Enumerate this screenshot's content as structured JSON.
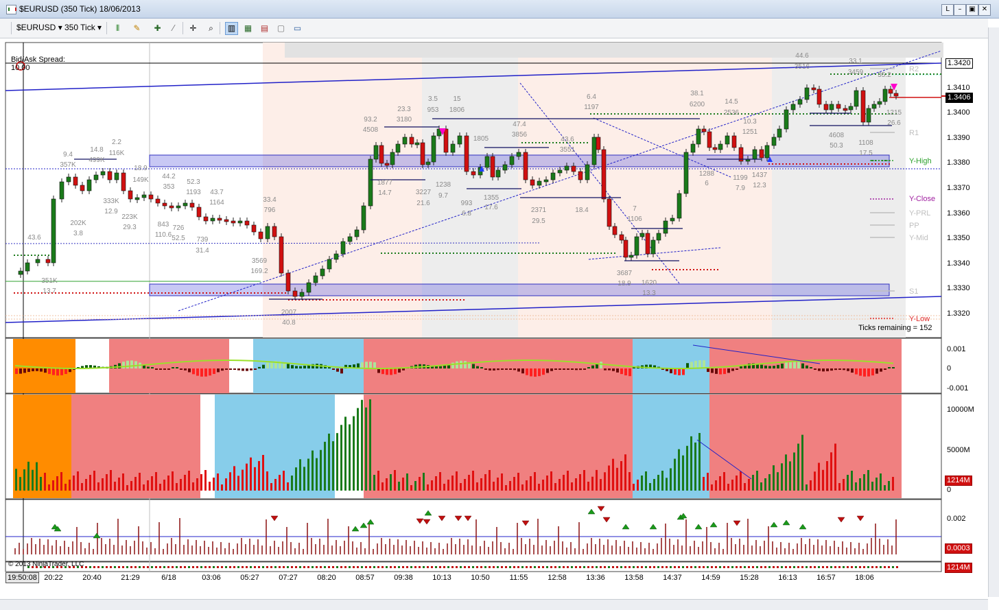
{
  "window": {
    "title": "$EURUSD (350 Tick)  18/06/2013",
    "controls": [
      "L",
      "–",
      "▣",
      "✕"
    ]
  },
  "toolbar": {
    "instrument": "$EURUSD",
    "interval": "350 Tick"
  },
  "overlay": {
    "spread_label": "Bid/Ask Spread:",
    "spread_value": "10.00",
    "ticks_remaining": "Ticks remaining = 152",
    "copyright": "© 2013 NinjaTrader, LLC",
    "clock": "19:50:08"
  },
  "price_axis": {
    "ticks": [
      "1.3410",
      "1.3400",
      "1.3390",
      "1.3380",
      "1.3370",
      "1.3360",
      "1.3350",
      "1.3340",
      "1.3330",
      "1.3320"
    ],
    "top_box": "1.3420",
    "last_price_box": "1.3406"
  },
  "levels_legend": [
    {
      "label": "R2",
      "color": "#bfbfbf"
    },
    {
      "label": "R1",
      "color": "#bfbfbf"
    },
    {
      "label": "Y-High",
      "color": "#2ca02c"
    },
    {
      "label": "Y-Close",
      "color": "#a020a0"
    },
    {
      "label": "Y-PRL",
      "color": "#bfbfbf"
    },
    {
      "label": "PP",
      "color": "#bfbfbf"
    },
    {
      "label": "Y-Mid",
      "color": "#bfbfbf"
    },
    {
      "label": "S1",
      "color": "#bfbfbf"
    },
    {
      "label": "Y-Low",
      "color": "#e03030"
    }
  ],
  "indicator1_axis": {
    "ticks": [
      "0.001",
      "0",
      "-0.001"
    ]
  },
  "indicator2_axis": {
    "ticks": [
      "10000M",
      "5000M",
      "0"
    ],
    "box": "1214M"
  },
  "indicator3_axis": {
    "ticks": [
      "0.002"
    ],
    "box": "0.0003"
  },
  "indicator4_axis": {
    "box": "1214M"
  },
  "time_axis": [
    "20:22",
    "20:40",
    "21:29",
    "6/18",
    "03:06",
    "05:27",
    "07:27",
    "08:20",
    "08:57",
    "09:38",
    "10:13",
    "10:50",
    "11:55",
    "12:58",
    "13:36",
    "13:58",
    "14:37",
    "14:59",
    "15:28",
    "16:13",
    "16:57",
    "18:06"
  ],
  "swing_labels": [
    "43.6",
    "9.4",
    "357K",
    "14.8",
    "499K",
    "2.2",
    "116K",
    "18.9",
    "149K",
    "44.2",
    "353",
    "52.3",
    "1193",
    "43.7",
    "1164",
    "202K",
    "3.8",
    "333K",
    "12.9",
    "223K",
    "29.3",
    "843",
    "110.6",
    "726",
    "52.5",
    "739",
    "31.4",
    "33.4",
    "796",
    "3569",
    "169.2",
    "351K",
    "13.7",
    "2007",
    "40.8",
    "93.2",
    "4508",
    "23.3",
    "3180",
    "3.5",
    "953",
    "15",
    "1806",
    "1877",
    "14.7",
    "3227",
    "21.6",
    "1238",
    "9.7",
    "993",
    "6.8",
    "1805",
    "1355",
    "17.6",
    "47.4",
    "3856",
    "43.6",
    "3551",
    "2371",
    "29.5",
    "18.4",
    "6.4",
    "1197",
    "7",
    "1106",
    "3687",
    "18.9",
    "1620",
    "13.3",
    "38.1",
    "6200",
    "14.5",
    "2536",
    "1288",
    "6",
    "10.3",
    "1251",
    "1199",
    "7.9",
    "1437",
    "12.3",
    "44.6",
    "3516",
    "33.1",
    "3459",
    "35.2",
    "4608",
    "50.3",
    "1108",
    "17.5",
    "1215",
    "26.6"
  ],
  "colors": {
    "bull": "#1a7a1a",
    "bear": "#d01010",
    "bg_pink": "#f08080",
    "bg_blue": "#87cdea",
    "bg_orange": "#ff8c00",
    "channel": "#2020c8",
    "zone": "#6060e0"
  }
}
